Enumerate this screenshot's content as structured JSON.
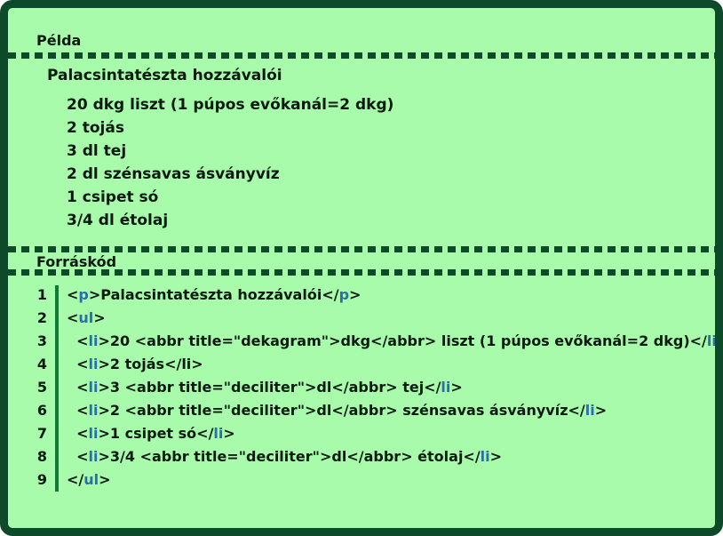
{
  "example_heading": "Példa",
  "recipe_title": "Palacsintatészta hozzávalói",
  "ingredients": [
    "20 dkg liszt (1 púpos evőkanál=2 dkg)",
    "2 tojás",
    "3 dl tej",
    "2 dl szénsavas ásványvíz",
    "1 csipet só",
    "3/4 dl étolaj"
  ],
  "source_heading": "Forráskód",
  "source_lines": [
    {
      "num": "1",
      "parts": [
        [
          "t",
          "<"
        ],
        [
          "k",
          "p"
        ],
        [
          "t",
          ">Palacsintatészta hozzávalói</"
        ],
        [
          "k",
          "p"
        ],
        [
          "t",
          ">"
        ]
      ]
    },
    {
      "num": "2",
      "parts": [
        [
          "t",
          "<"
        ],
        [
          "k",
          "ul"
        ],
        [
          "t",
          ">"
        ]
      ]
    },
    {
      "num": "3",
      "parts": [
        [
          "t",
          "  <"
        ],
        [
          "k",
          "li"
        ],
        [
          "t",
          ">20 <abbr title=\"dekagram\">dkg</abbr> liszt (1 púpos evőkanál=2 dkg)</"
        ],
        [
          "k",
          "li"
        ],
        [
          "t",
          ">"
        ]
      ]
    },
    {
      "num": "4",
      "parts": [
        [
          "t",
          "  <"
        ],
        [
          "k",
          "li"
        ],
        [
          "t",
          ">2 tojás</li>"
        ]
      ]
    },
    {
      "num": "5",
      "parts": [
        [
          "t",
          "  <"
        ],
        [
          "k",
          "li"
        ],
        [
          "t",
          ">3 <abbr title=\"deciliter\">dl</abbr> tej</"
        ],
        [
          "k",
          "li"
        ],
        [
          "t",
          ">"
        ]
      ]
    },
    {
      "num": "6",
      "parts": [
        [
          "t",
          "  <"
        ],
        [
          "k",
          "li"
        ],
        [
          "t",
          ">2 <abbr title=\"deciliter\">dl</abbr> szénsavas ásványvíz</"
        ],
        [
          "k",
          "li"
        ],
        [
          "t",
          ">"
        ]
      ]
    },
    {
      "num": "7",
      "parts": [
        [
          "t",
          "  <"
        ],
        [
          "k",
          "li"
        ],
        [
          "t",
          ">1 csipet só</"
        ],
        [
          "k",
          "li"
        ],
        [
          "t",
          ">"
        ]
      ]
    },
    {
      "num": "8",
      "parts": [
        [
          "t",
          "  <"
        ],
        [
          "k",
          "li"
        ],
        [
          "t",
          ">3/4 <abbr title=\"deciliter\">dl</abbr> étolaj</"
        ],
        [
          "k",
          "li"
        ],
        [
          "t",
          ">"
        ]
      ]
    },
    {
      "num": "9",
      "parts": [
        [
          "t",
          "</"
        ],
        [
          "k",
          "ul"
        ],
        [
          "t",
          ">"
        ]
      ]
    }
  ],
  "colors": {
    "background": "#a8fbaa",
    "border": "#0d4a2a",
    "tag_name": "#2b6eaa",
    "gutter_bar": "#0e7a36"
  }
}
